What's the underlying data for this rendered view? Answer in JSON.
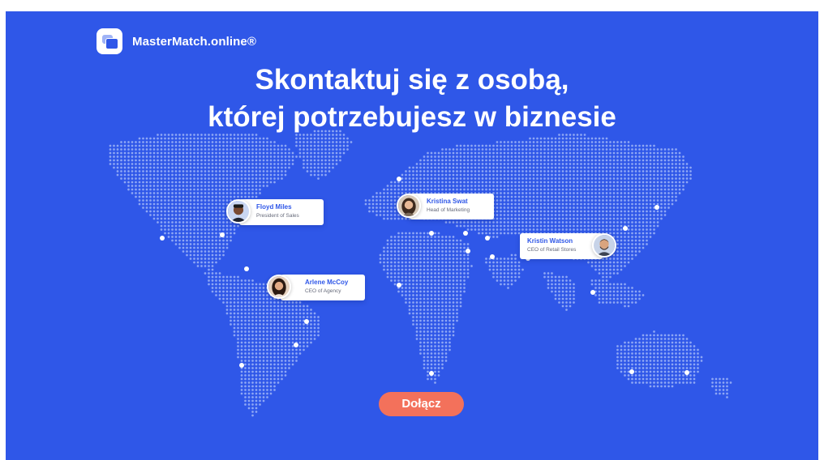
{
  "brand": {
    "name": "MasterMatch.online®",
    "logo": "chat-window-icon"
  },
  "headline": {
    "line1": "Skontaktuj się z osobą,",
    "line2": "której potrzebujesz w biznesie"
  },
  "people": [
    {
      "name": "Floyd Miles",
      "role": "President of Sales"
    },
    {
      "name": "Kristina Swat",
      "role": "Head of Marketing"
    },
    {
      "name": "Arlene McCoy",
      "role": "CEO of Agency"
    },
    {
      "name": "Kristin Watson",
      "role": "CEO of Retail Stores"
    }
  ],
  "cta": {
    "label": "Dołącz"
  },
  "colors": {
    "background": "#2f57e8",
    "map_dots": "#8ea7f5",
    "markers": "#ffffff",
    "name_text": "#2f57e8",
    "cta": "#f3715b"
  }
}
